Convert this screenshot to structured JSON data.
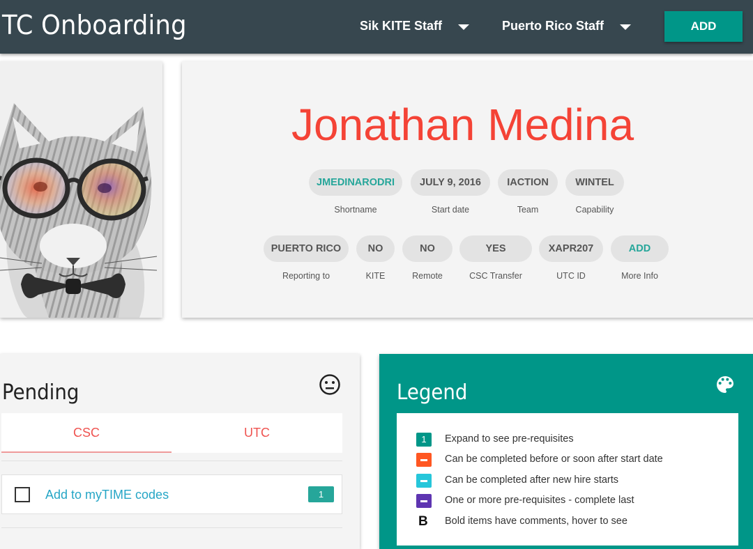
{
  "header": {
    "app_title": "TC Onboarding",
    "dropdown_kite": "Sik KITE Staff",
    "dropdown_location": "Puerto Rico Staff",
    "add_button": "ADD"
  },
  "profile": {
    "name": "Jonathan Medina",
    "fields_row1": [
      {
        "value": "JMEDINARODRI",
        "label": "Shortname",
        "accent": true
      },
      {
        "value": "JULY 9, 2016",
        "label": "Start date"
      },
      {
        "value": "IACTION",
        "label": "Team"
      },
      {
        "value": "WINTEL",
        "label": "Capability"
      }
    ],
    "fields_row2": [
      {
        "value": "PUERTO RICO",
        "label": "Reporting to"
      },
      {
        "value": "NO",
        "label": "KITE"
      },
      {
        "value": "NO",
        "label": "Remote"
      },
      {
        "value": "YES",
        "label": "CSC Transfer"
      },
      {
        "value": "XAPR207",
        "label": "UTC ID"
      },
      {
        "value": "ADD",
        "label": "More Info",
        "accent": true
      }
    ]
  },
  "pending": {
    "title": "Pending",
    "status_icon": "neutral-face-icon",
    "tabs": [
      "CSC",
      "UTC"
    ],
    "active_tab": "CSC",
    "tasks": [
      {
        "label": "Add to myTIME codes",
        "badge": "1",
        "checked": false
      }
    ]
  },
  "legend": {
    "title": "Legend",
    "icon": "palette-icon",
    "items": [
      {
        "marker": "1",
        "color": "#009688",
        "text": "Expand to see pre-requisites"
      },
      {
        "marker": "dash",
        "color": "#ff5722",
        "text": "Can be completed before or soon after start date"
      },
      {
        "marker": "dash",
        "color": "#26c6da",
        "text": "Can be completed after new hire starts"
      },
      {
        "marker": "dash",
        "color": "#5e35b1",
        "text": "One or more pre-requisites - complete last"
      },
      {
        "marker": "B",
        "color": "#111111",
        "text": "Bold items have comments, hover to see"
      }
    ]
  },
  "colors": {
    "header_bg": "#37474f",
    "accent": "#009688",
    "name": "#f44336",
    "link": "#26a6c6",
    "tab": "#ef5350"
  }
}
